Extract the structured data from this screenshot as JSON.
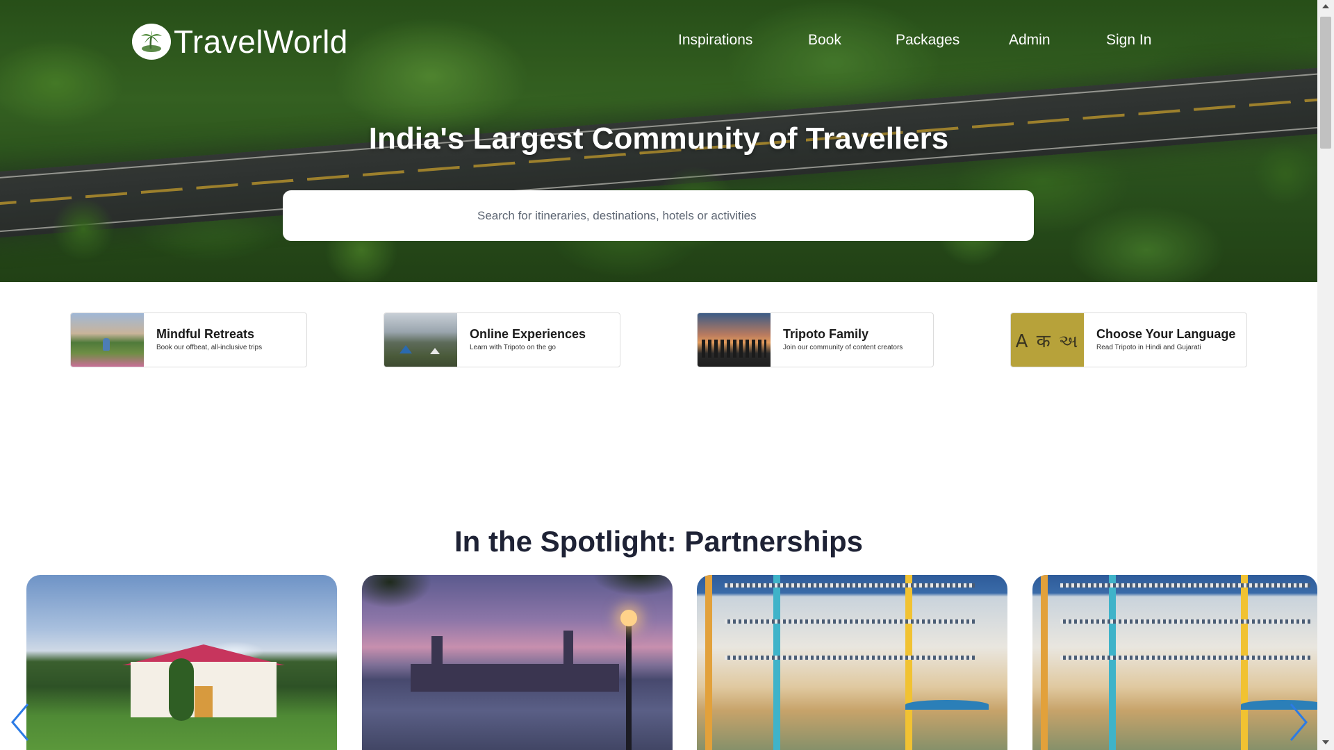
{
  "brand": {
    "name": "TravelWorld"
  },
  "nav": {
    "items": [
      {
        "label": "Inspirations"
      },
      {
        "label": "Book"
      },
      {
        "label": "Packages"
      },
      {
        "label": "Admin"
      },
      {
        "label": "Sign In"
      }
    ]
  },
  "hero": {
    "title": "India's Largest Community of Travellers",
    "search_placeholder": "Search for itineraries, destinations, hotels or activities"
  },
  "features": [
    {
      "title": "Mindful Retreats",
      "subtitle": "Book our offbeat, all-inclusive trips"
    },
    {
      "title": "Online Experiences",
      "subtitle": "Learn with Tripoto on the go"
    },
    {
      "title": "Tripoto Family",
      "subtitle": "Join our community of content creators"
    },
    {
      "title": "Choose Your Language",
      "subtitle": "Read Tripoto in Hindi and Gujarati",
      "thumb_text": "A क અ"
    }
  ],
  "spotlight": {
    "title": "In the Spotlight: Partnerships"
  },
  "colors": {
    "heading": "#1e2235",
    "accent_arrow": "#2c7be5",
    "language_tile": "#b7a23a"
  }
}
